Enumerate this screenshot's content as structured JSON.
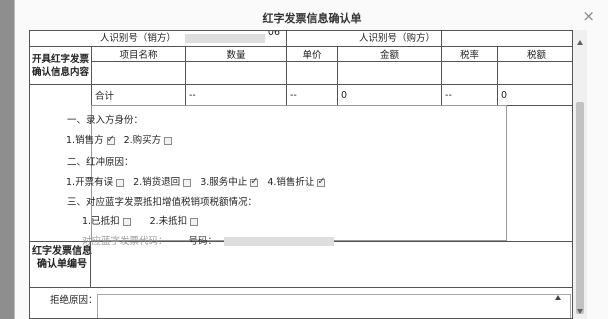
{
  "dialog": {
    "title": "红字发票信息确认单",
    "close_glyph": "×"
  },
  "form": {
    "seller_id_label": "人识别号（销方）",
    "seller_id_value_fragment": "06",
    "buyer_id_label": "人识别号（购方）",
    "invoice_label": "开具红字发票确认信息内容",
    "columns": [
      "项目名称",
      "数量",
      "单价",
      "金额",
      "税率",
      "税额"
    ],
    "total_row": [
      "合计",
      "--",
      "--",
      "0",
      "--",
      "0"
    ],
    "confirm_no_label": "红字发票信息确认单编号",
    "reason_label": "拒绝原因："
  },
  "choices": {
    "role_heading": "一、录入方身份：",
    "role_seller": "1.销售方",
    "role_buyer": "2.购买方",
    "reason_heading": "二、红冲原因：",
    "reason_1": "1.开票有误",
    "reason_2": "2.销货退回",
    "reason_3": "3.服务中止",
    "reason_4": "4.销售折让",
    "deduct_heading": "三、对应蓝字发票抵扣增值税销项税额情况：",
    "deduct_1": "1.已抵扣",
    "deduct_2": "2.未抵扣",
    "blue_code_label": "对应蓝字发票代码：",
    "number_label": "号码："
  },
  "checkbox_state": {
    "role_seller": true,
    "role_buyer": false,
    "reason_1": false,
    "reason_2": false,
    "reason_3": true,
    "reason_4": true,
    "deduct_1": false,
    "deduct_2": false
  },
  "colors": {
    "border": "#555555",
    "backdrop": "#9a9a9a",
    "scroll_thumb": "#c2c2c2"
  }
}
